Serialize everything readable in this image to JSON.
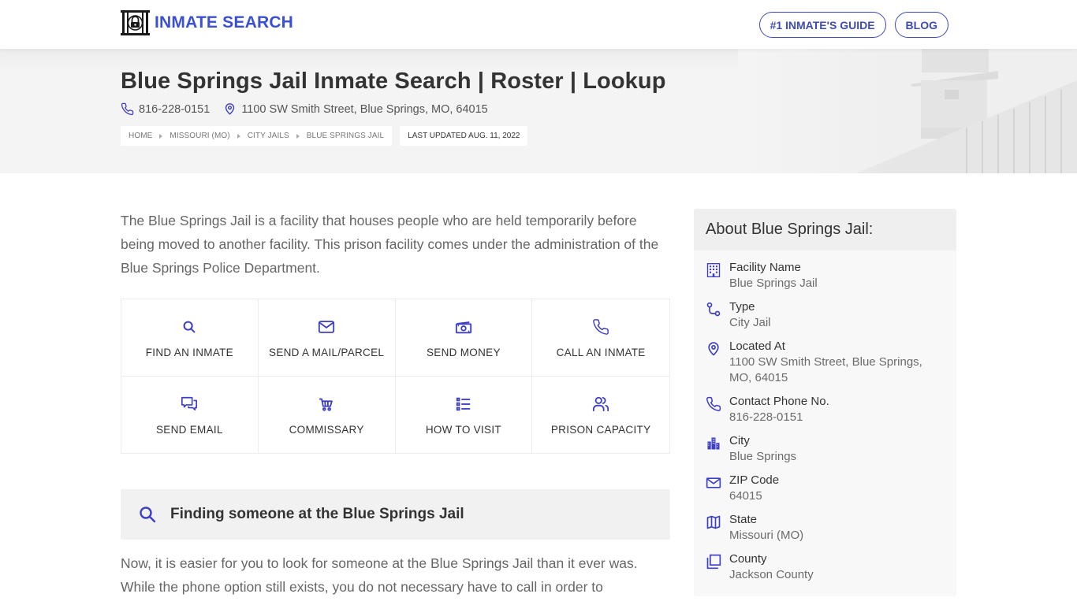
{
  "header": {
    "brand": "INMATE SEARCH",
    "nav": [
      {
        "label": "#1 INMATE'S GUIDE"
      },
      {
        "label": "BLOG"
      }
    ]
  },
  "hero": {
    "title": "Blue Springs Jail Inmate Search | Roster | Lookup",
    "phone": "816-228-0151",
    "address": "1100 SW Smith Street, Blue Springs, MO, 64015",
    "breadcrumbs": [
      "HOME",
      "MISSOURI (MO)",
      "CITY JAILS",
      "BLUE SPRINGS JAIL"
    ],
    "last_updated": "LAST UPDATED AUG. 11, 2022"
  },
  "main": {
    "intro": "The Blue Springs Jail is a facility that houses people who are held temporarily before being moved to another facility. This prison facility comes under the administration of the Blue Springs Police Department.",
    "actions": [
      {
        "label": "FIND AN INMATE",
        "icon": "search-icon"
      },
      {
        "label": "SEND A MAIL/PARCEL",
        "icon": "envelope-icon"
      },
      {
        "label": "SEND MONEY",
        "icon": "money-icon"
      },
      {
        "label": "CALL AN INMATE",
        "icon": "phone-icon"
      },
      {
        "label": "SEND EMAIL",
        "icon": "chat-icon"
      },
      {
        "label": "COMMISSARY",
        "icon": "cart-icon"
      },
      {
        "label": "HOW TO VISIT",
        "icon": "list-icon"
      },
      {
        "label": "PRISON CAPACITY",
        "icon": "users-icon"
      }
    ],
    "finding_heading": "Finding someone at the Blue Springs Jail",
    "finding_text": "Now, it is easier for you to look for someone at the Blue Springs Jail than it ever was. While the phone option still exists, you do not necessary have to call in order to"
  },
  "sidebar": {
    "title": "About Blue Springs Jail:",
    "items": [
      {
        "key": "Facility Name",
        "value": "Blue Springs Jail",
        "icon": "building-icon"
      },
      {
        "key": "Type",
        "value": "City Jail",
        "icon": "route-icon"
      },
      {
        "key": "Located At",
        "value": "1100 SW Smith Street, Blue Springs, MO, 64015",
        "icon": "map-pin-icon"
      },
      {
        "key": "Contact Phone No.",
        "value": "816-228-0151",
        "icon": "phone-icon"
      },
      {
        "key": "City",
        "value": "Blue Springs",
        "icon": "city-icon"
      },
      {
        "key": "ZIP Code",
        "value": "64015",
        "icon": "mail-icon"
      },
      {
        "key": "State",
        "value": "Missouri (MO)",
        "icon": "map-icon"
      },
      {
        "key": "County",
        "value": "Jackson County",
        "icon": "copy-icon"
      }
    ]
  },
  "colors": {
    "accent": "#3a4fd6",
    "icon": "#3d3fc4",
    "text": "#333333",
    "muted": "#666666"
  }
}
